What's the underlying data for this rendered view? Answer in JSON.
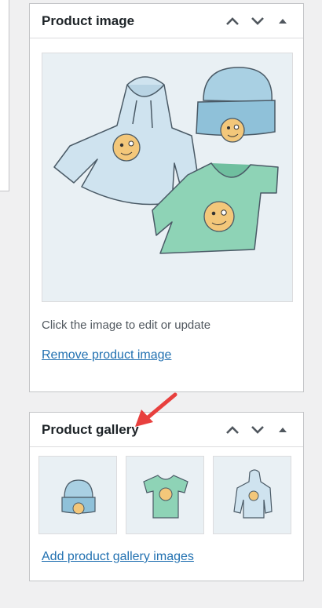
{
  "product_image": {
    "title": "Product image",
    "hint": "Click the image to edit or update",
    "remove_link": "Remove product image"
  },
  "product_gallery": {
    "title": "Product gallery",
    "add_link": "Add product gallery images",
    "thumbnails": [
      "beanie",
      "tshirt",
      "hoodie"
    ]
  },
  "icons": {
    "move_up": "chevron-up-icon",
    "move_down": "chevron-down-icon",
    "toggle": "triangle-up-icon",
    "annotation": "red-arrow"
  },
  "colors": {
    "link": "#2271b1",
    "arrow": "#e8403e",
    "hoodie": "#cfe3ef",
    "beanie": "#8fc1d9",
    "tshirt": "#8ed3b6",
    "smiley": "#f3c77a"
  }
}
